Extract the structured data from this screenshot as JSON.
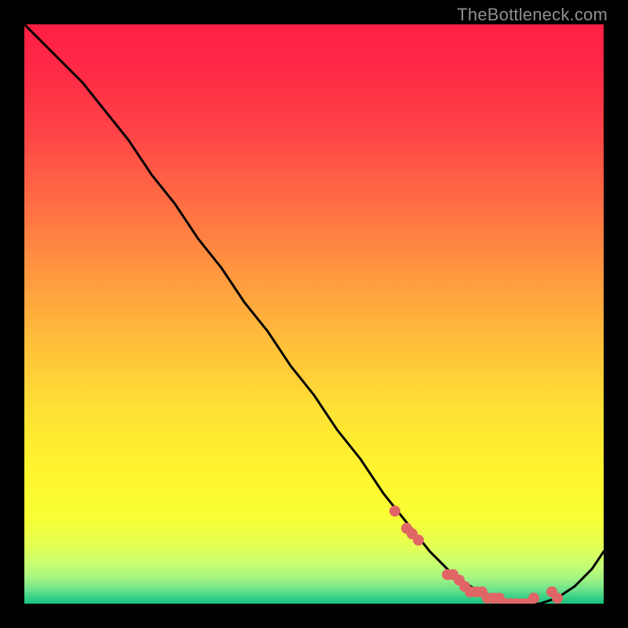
{
  "watermark": "TheBottleneck.com",
  "colors": {
    "black": "#000000",
    "curve": "#000000",
    "marker": "#e06666"
  },
  "chart_data": {
    "type": "line",
    "title": "",
    "xlabel": "",
    "ylabel": "",
    "xlim": [
      0,
      100
    ],
    "ylim": [
      0,
      100
    ],
    "grid": false,
    "curve": {
      "name": "bottleneck-curve",
      "x": [
        0,
        3,
        6,
        10,
        14,
        18,
        22,
        26,
        30,
        34,
        38,
        42,
        46,
        50,
        54,
        58,
        62,
        66,
        70,
        74,
        77,
        80,
        83,
        86,
        89,
        92,
        95,
        98,
        100
      ],
      "y": [
        100,
        97,
        94,
        90,
        85,
        80,
        74,
        69,
        63,
        58,
        52,
        47,
        41,
        36,
        30,
        25,
        19,
        14,
        9,
        5,
        3,
        1,
        0,
        0,
        0,
        1,
        3,
        6,
        9
      ]
    },
    "markers": {
      "name": "highlighted-points",
      "x": [
        64,
        66,
        67,
        68,
        73,
        74,
        75,
        76,
        77,
        78,
        79,
        80,
        81,
        82,
        83,
        84,
        85,
        86,
        87,
        88,
        91,
        92
      ],
      "y": [
        16,
        13,
        12,
        11,
        5,
        5,
        4,
        3,
        2,
        2,
        2,
        1,
        1,
        1,
        0,
        0,
        0,
        0,
        0,
        1,
        2,
        1
      ]
    },
    "gradient_stops": [
      {
        "offset": 0.0,
        "color": "#ff1f44"
      },
      {
        "offset": 0.08,
        "color": "#ff2a46"
      },
      {
        "offset": 0.18,
        "color": "#ff4247"
      },
      {
        "offset": 0.3,
        "color": "#ff6a44"
      },
      {
        "offset": 0.42,
        "color": "#ff9440"
      },
      {
        "offset": 0.55,
        "color": "#ffbf3a"
      },
      {
        "offset": 0.67,
        "color": "#ffe234"
      },
      {
        "offset": 0.78,
        "color": "#fff62e"
      },
      {
        "offset": 0.85,
        "color": "#f8ff34"
      },
      {
        "offset": 0.9,
        "color": "#e4ff53"
      },
      {
        "offset": 0.93,
        "color": "#c9ff70"
      },
      {
        "offset": 0.955,
        "color": "#a6f583"
      },
      {
        "offset": 0.975,
        "color": "#6fe38a"
      },
      {
        "offset": 0.99,
        "color": "#35cf86"
      },
      {
        "offset": 1.0,
        "color": "#1bc07f"
      }
    ]
  }
}
